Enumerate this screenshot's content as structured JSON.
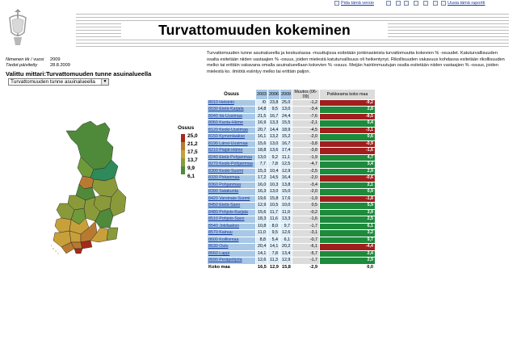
{
  "toolbar": {
    "print_label": "Pida tämä versio",
    "new_report_label": "Uusia tämä raportti"
  },
  "header": {
    "title": "Turvattomuuden kokeminen",
    "meta": [
      {
        "label": "Nimenen kk / vuosi",
        "value": "2009"
      },
      {
        "label": "Tiedot päivitetty",
        "value": "28.8.2009"
      }
    ]
  },
  "indicator": {
    "label": "Valittu mittari:Turvattomuuden  tunne asuinalueella",
    "select_value": "Turvattomuuden  tunne asuinalueella"
  },
  "legend": {
    "title": "Osuus",
    "items": [
      {
        "label": "25,0",
        "color": "#a52a1a"
      },
      {
        "label": "21,2",
        "color": "#b87a32"
      },
      {
        "label": "17,5",
        "color": "#c8a03a"
      },
      {
        "label": "13,7",
        "color": "#8a9a3a"
      },
      {
        "label": "9,9",
        "color": "#4f8a3a"
      },
      {
        "label": "6,1",
        "color": "#2e8a5a"
      }
    ]
  },
  "description": "Turvattomuuden tunne asuinalueella ja keskustassa -muuttujissa esitetään jonkinasteista turvattomuutta kokevien % -osuudet. Katuturvallisuuden osalta esitetään niiden vastaajien % -osuus, joiden mielestä katuturvallisuus oli heikentynyt. Rikollisuuden vakavuus kohdassa esitetään rikollisuuden melko tai erittäin vakavana omalla asuinalueellaan kokevien % -osuus. Meijän hairiönmuutujan osalta esitetään niiden vastaajien % -osuus, joiden mielestä ko. ilmiötä esiintyy melko tai erittäin paljon.",
  "table": {
    "headers": [
      "Osuus",
      "2003",
      "2006",
      "2009",
      "Muutos (06-09)",
      "Poikkeama koko maa"
    ],
    "colors": {
      "positive": "#1e8a3c",
      "negative": "#a01e1e"
    },
    "rows": [
      {
        "name": "8010 Helsinki",
        "v2003": "/0",
        "v2006": "23,8",
        "v2009": "25,0",
        "change": "-1,2",
        "dev": "-9,2",
        "sign": "neg"
      },
      {
        "name": "8030 Etelä-Karjala",
        "v2003": "14,8",
        "v2006": "9,5",
        "v2009": "13,0",
        "change": "-3,4",
        "dev": "2,8",
        "sign": "pos"
      },
      {
        "name": "8040 Itä-Uusimaa",
        "v2003": "21,5",
        "v2006": "16,7",
        "v2009": "24,4",
        "change": "-7,6",
        "dev": "-8,5",
        "sign": "neg"
      },
      {
        "name": "8060 Kanta-Häme",
        "v2003": "16,9",
        "v2006": "13,3",
        "v2009": "15,5",
        "change": "-2,1",
        "dev": "0,4",
        "sign": "pos"
      },
      {
        "name": "8120 Keski-Uusimaa",
        "v2003": "20,7",
        "v2006": "14,4",
        "v2009": "18,9",
        "change": "-4,5",
        "dev": "-3,1",
        "sign": "neg"
      },
      {
        "name": "8150 Kymenlaakso",
        "v2003": "16,1",
        "v2006": "13,2",
        "v2009": "15,2",
        "change": "-2,0",
        "dev": "0,6",
        "sign": "pos"
      },
      {
        "name": "8190 Länsi-Uusimaa",
        "v2003": "15,6",
        "v2006": "13,0",
        "v2009": "16,7",
        "change": "-3,8",
        "dev": "-0,9",
        "sign": "neg"
      },
      {
        "name": "8210 Päijät-Häme",
        "v2003": "18,8",
        "v2006": "13,6",
        "v2009": "17,4",
        "change": "-3,8",
        "dev": "-1,6",
        "sign": "neg"
      },
      {
        "name": "8240 Etelä-Pohjanmaa",
        "v2003": "13,0",
        "v2006": "9,2",
        "v2009": "11,1",
        "change": "-1,9",
        "dev": "4,7",
        "sign": "pos"
      },
      {
        "name": "8270 Keski-Pohjanmaa",
        "v2003": "7,7",
        "v2006": "7,8",
        "v2009": "12,5",
        "change": "-4,7",
        "dev": "3,4",
        "sign": "pos"
      },
      {
        "name": "8300 Keski-Suomi",
        "v2003": "15,3",
        "v2006": "10,4",
        "v2009": "12,9",
        "change": "-2,5",
        "dev": "2,9",
        "sign": "pos"
      },
      {
        "name": "8330 Pirkanmaa",
        "v2003": "17,2",
        "v2006": "14,5",
        "v2009": "16,4",
        "change": "-2,0",
        "dev": "-0,6",
        "sign": "neg"
      },
      {
        "name": "8360 Pohjanmaa",
        "v2003": "16,0",
        "v2006": "10,3",
        "v2009": "13,8",
        "change": "-3,4",
        "dev": "2,1",
        "sign": "pos"
      },
      {
        "name": "8390 Satakunta",
        "v2003": "16,3",
        "v2006": "13,0",
        "v2009": "15,0",
        "change": "-2,0",
        "dev": "0,9",
        "sign": "pos"
      },
      {
        "name": "8420 Varsinais-Suomi",
        "v2003": "19,6",
        "v2006": "15,8",
        "v2009": "17,6",
        "change": "-1,9",
        "dev": "-1,8",
        "sign": "neg"
      },
      {
        "name": "8450 Etelä-Savo",
        "v2003": "12,9",
        "v2006": "10,5",
        "v2009": "10,0",
        "change": "0,5",
        "dev": "5,9",
        "sign": "pos"
      },
      {
        "name": "8480 Pohjois-Karjala",
        "v2003": "15,6",
        "v2006": "11,7",
        "v2009": "11,9",
        "change": "-0,2",
        "dev": "3,9",
        "sign": "pos"
      },
      {
        "name": "8510 Pohjois-Savo",
        "v2003": "18,3",
        "v2006": "11,6",
        "v2009": "13,3",
        "change": "-1,6",
        "dev": "2,5",
        "sign": "pos"
      },
      {
        "name": "8540 Jokilaakso",
        "v2003": "10,8",
        "v2006": "8,0",
        "v2009": "9,7",
        "change": "-1,7",
        "dev": "6,1",
        "sign": "pos"
      },
      {
        "name": "8570 Kainuu",
        "v2003": "11,0",
        "v2006": "9,5",
        "v2009": "12,6",
        "change": "-3,1",
        "dev": "3,2",
        "sign": "pos"
      },
      {
        "name": "8600 Koillismaa",
        "v2003": "8,8",
        "v2006": "5,4",
        "v2009": "6,1",
        "change": "-0,7",
        "dev": "9,7",
        "sign": "pos"
      },
      {
        "name": "8630 Oulu",
        "v2003": "20,4",
        "v2006": "14,1",
        "v2009": "20,2",
        "change": "-6,1",
        "dev": "-4,4",
        "sign": "neg"
      },
      {
        "name": "8660 Lappi",
        "v2003": "14,1",
        "v2006": "7,8",
        "v2009": "13,4",
        "change": "-5,7",
        "dev": "2,4",
        "sign": "pos"
      },
      {
        "name": "8690 Peräpohjola",
        "v2003": "12,6",
        "v2006": "11,3",
        "v2009": "12,9",
        "change": "-1,7",
        "dev": "2,9",
        "sign": "pos"
      }
    ],
    "total": {
      "name": "Koko maa",
      "v2003": "16,5",
      "v2006": "12,9",
      "v2009": "15,8",
      "change": "-2,9",
      "dev": "0,0"
    }
  }
}
